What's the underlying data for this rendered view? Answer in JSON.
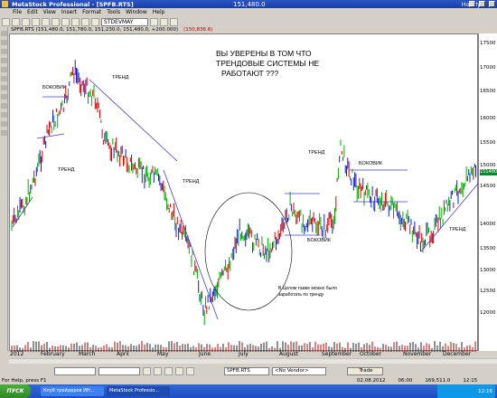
{
  "window": {
    "app_title": "MetaStock Professional - [SPFB.RTS]",
    "price_title": "151,480.0",
    "period": "Hourly"
  },
  "menu": [
    "File",
    "Edit",
    "View",
    "Insert",
    "Format",
    "Tools",
    "Window",
    "Help"
  ],
  "toolbar": {
    "indicator_select": "STDEVMAY"
  },
  "chart_tab": {
    "ohlc": "SPFB.RTS (151,480.0, 151,780.0, 151,230.0, 151,480.0, +200.000)",
    "indicator": "(150,836.6)"
  },
  "axis": {
    "labels": [
      "17500",
      "17000",
      "16500",
      "16000",
      "15500",
      "15000",
      "14500",
      "14000",
      "13500",
      "13000",
      "12500",
      "12000"
    ],
    "current_price": "151480"
  },
  "months": [
    "2012",
    "February",
    "March",
    "April",
    "May",
    "June",
    "July",
    "August",
    "September",
    "October",
    "November",
    "December"
  ],
  "annotations": {
    "headline": [
      "ВЫ УВЕРЕНЫ В ТОМ ЧТО",
      "ТРЕНДОВЫЕ СИСТЕМЫ НЕ",
      "РАБОТАЮТ ???"
    ],
    "trend": "ТРЕНД",
    "sideways": "БОКОВИК",
    "note": [
      "В Целом также можно было",
      "заработать по тренду"
    ]
  },
  "bottom_bar": {
    "symbol": "SPFB.RTS",
    "vendor": "<No Vendor>",
    "trade": "Trade"
  },
  "status": {
    "help": "For Help, press F1",
    "date": "02.08.2012",
    "time": "06:00",
    "value": "169,511.0",
    "clock": "12:15"
  },
  "taskbar": {
    "start": "ПУСК",
    "tasks": [
      "Клуб трейдеров ИН...",
      "MetaStock Professio..."
    ],
    "tray_time": "12:16"
  },
  "colors": {
    "up": "#00b000",
    "down": "#e00000",
    "mid": "#1020c0",
    "trendline": "#4040c0",
    "accent": "#1a3e9e"
  }
}
